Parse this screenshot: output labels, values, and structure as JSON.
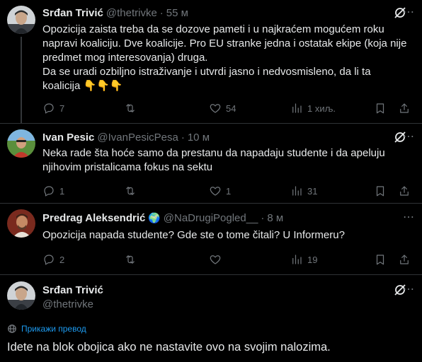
{
  "tweets": [
    {
      "author": "Srđan Trivić",
      "handle": "@thetrivke",
      "time": "55 м",
      "text": "Opozicija zaista treba da se dozove pameti i u najkraćem mogućem roku napravi koaliciju. Dve koalicije. Pro EU stranke jedna i ostatak ekipe (koja nije predmet mog interesovanja) druga.\nDa se uradi ozbiljno istraživanje i utvrdi jasno i nedvosmisleno, da li ta koalicija 👇👇👇",
      "replies": "7",
      "reposts": "",
      "likes": "54",
      "views": "1 хиљ."
    },
    {
      "author": "Ivan Pesic",
      "handle": "@IvanPesicPesa",
      "time": "10 м",
      "text": "Neka rade šta hoće samo da prestanu da napadaju studente i da apeluju njihovim pristalicama fokus na sektu",
      "replies": "1",
      "reposts": "",
      "likes": "1",
      "views": "31"
    },
    {
      "author": "Predrag Aleksendrić",
      "author_emoji": "🌍",
      "handle": "@NaDrugiPogled__",
      "time": "8 м",
      "text": "Opozicija napada studente? Gde ste o tome čitali? U Informeru?",
      "replies": "2",
      "reposts": "",
      "likes": "",
      "views": "19"
    }
  ],
  "main_tweet": {
    "author": "Srđan Trivić",
    "handle": "@thetrivke",
    "translate_label": "Прикажи превод",
    "text": "Idete na blok obojica ako ne nastavite ovo na svojim nalozima."
  },
  "colors": {
    "background": "#000000",
    "text": "#e7e9ea",
    "muted": "#71767b",
    "link": "#1d9bf0",
    "divider": "#2f3336"
  },
  "icons": {
    "reply": "reply-icon",
    "repost": "repost-icon",
    "like": "like-icon",
    "views": "views-icon",
    "bookmark": "bookmark-icon",
    "share": "share-icon",
    "grok": "grok-icon",
    "more": "more-icon",
    "translate": "globe-icon"
  }
}
